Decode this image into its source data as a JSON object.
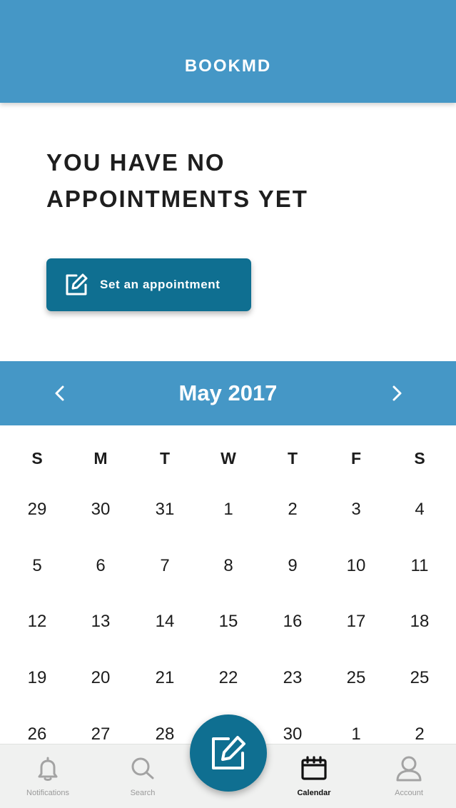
{
  "app": {
    "title": "BOOKMD"
  },
  "empty_state": {
    "title_line1": "YOU HAVE NO",
    "title_line2": "APPOINTMENTS YET",
    "button_label": "Set an appointment",
    "button_icon": "edit-icon"
  },
  "calendar": {
    "month_label": "May 2017",
    "prev_icon": "chevron-left-icon",
    "next_icon": "chevron-right-icon",
    "weekdays": [
      "S",
      "M",
      "T",
      "W",
      "T",
      "F",
      "S"
    ],
    "weeks": [
      [
        "29",
        "30",
        "31",
        "1",
        "2",
        "3",
        "4"
      ],
      [
        "5",
        "6",
        "7",
        "8",
        "9",
        "10",
        "11"
      ],
      [
        "12",
        "13",
        "14",
        "15",
        "16",
        "17",
        "18"
      ],
      [
        "19",
        "20",
        "21",
        "22",
        "23",
        "25",
        "25"
      ],
      [
        "26",
        "27",
        "28",
        "",
        "30",
        "1",
        "2"
      ]
    ]
  },
  "tabbar": {
    "items": [
      {
        "label": "Notifications",
        "icon": "bell-icon",
        "active": false
      },
      {
        "label": "Search",
        "icon": "search-icon",
        "active": false
      },
      {
        "label": "Calendar",
        "icon": "calendar-icon",
        "active": true
      },
      {
        "label": "Account",
        "icon": "user-icon",
        "active": false
      }
    ],
    "fab_icon": "edit-icon"
  },
  "colors": {
    "header_blue": "#4597c6",
    "button_teal": "#0f6f91",
    "text_dark": "#1c1c1c",
    "tab_inactive": "#9a9a9a"
  }
}
